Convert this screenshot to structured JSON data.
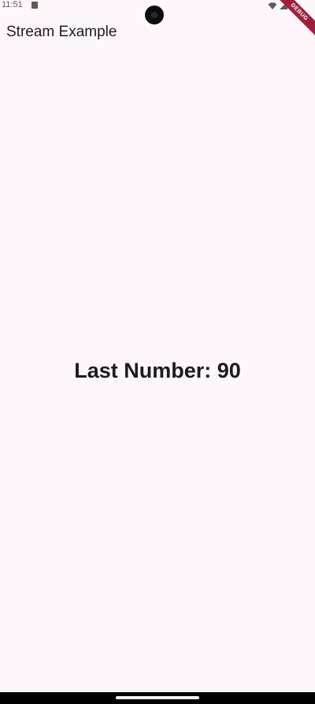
{
  "status_bar": {
    "time": "11:51",
    "icons": [
      "sim-card-icon",
      "wifi-icon",
      "battery-icon"
    ]
  },
  "debug_banner": {
    "label": "DEBUG",
    "color": "#a0203c"
  },
  "app_bar": {
    "title": "Stream Example"
  },
  "body": {
    "last_number_text": "Last Number: 90"
  },
  "colors": {
    "background": "#fdf7fc",
    "text": "#1d1b20",
    "nav_bar": "#000000"
  }
}
